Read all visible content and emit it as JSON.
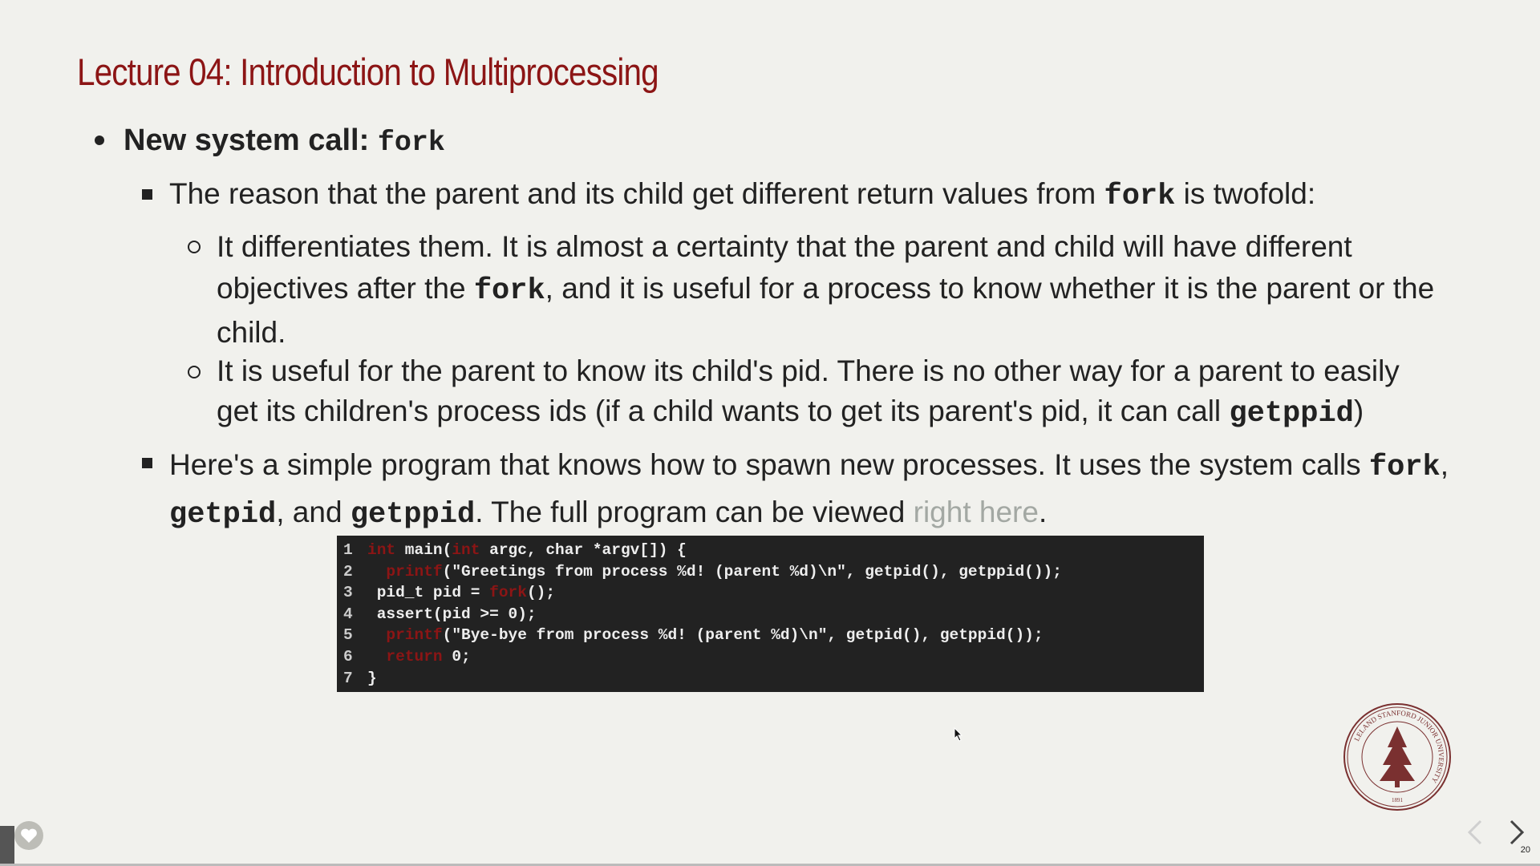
{
  "slide": {
    "title": "Lecture 04: Introduction to Multiprocessing",
    "bullet1": {
      "label": "New system call: ",
      "code": "fork"
    },
    "sub1": {
      "t1": "The reason that the parent and its child get different return values from ",
      "code": "fork",
      "t2": " is twofold:"
    },
    "circ1": {
      "line1": "It differentiates them. It is almost a certainty that the parent and child will have different",
      "line2a": "objectives after the ",
      "line2code": "fork",
      "line2b": ", and it is useful for a process to know whether it is the parent or the",
      "line3": "child."
    },
    "circ2": {
      "line1": "It is useful for the parent to know its child's pid. There is no other way for a parent to easily",
      "line2a": "get its children's process ids (if a child wants to get its parent's pid, it can call ",
      "line2code": "getppid",
      "line2b": ")"
    },
    "sub2": {
      "line1a": "Here's a simple program that knows how to spawn new processes. It uses the system calls ",
      "line1code": "fork",
      "line1b": ",",
      "line2code1": "getpid",
      "line2a": ", and ",
      "line2code2": "getppid",
      "line2b": ". The full program can be viewed ",
      "link": "right here",
      "line2c": "."
    }
  },
  "code": {
    "lines": [
      {
        "n": "1",
        "parts": [
          [
            "kw",
            "int"
          ],
          [
            "",
            "  main("
          ],
          [
            "kw",
            "int"
          ],
          [
            "",
            "  argc, char *argv[]) {"
          ]
        ]
      },
      {
        "n": "2",
        "parts": [
          [
            "",
            "  "
          ],
          [
            "kw",
            "printf"
          ],
          [
            "",
            "(\"Greetings from process %d! (parent %d)\\n\", getpid(), getppid());"
          ]
        ]
      },
      {
        "n": "3",
        "parts": [
          [
            "",
            "  pid_t pid = "
          ],
          [
            "kw",
            "fork"
          ],
          [
            "",
            "();"
          ]
        ]
      },
      {
        "n": "4",
        "parts": [
          [
            "",
            "  assert(pid >= 0);"
          ]
        ]
      },
      {
        "n": "5",
        "parts": [
          [
            "",
            "  "
          ],
          [
            "kw",
            "printf"
          ],
          [
            "",
            "(\"Bye-bye from process %d! (parent %d)\\n\", getpid(), getppid());"
          ]
        ]
      },
      {
        "n": "6",
        "parts": [
          [
            "",
            "  "
          ],
          [
            "kw",
            "return"
          ],
          [
            "",
            " 0;"
          ]
        ]
      },
      {
        "n": "7",
        "parts": [
          [
            "",
            "}"
          ]
        ]
      }
    ]
  },
  "seal": {
    "text": "LELAND STANFORD JUNIOR UNIVERSITY",
    "year": "1891"
  },
  "nav": {
    "prev": "‹",
    "next": "›",
    "page": "20"
  }
}
